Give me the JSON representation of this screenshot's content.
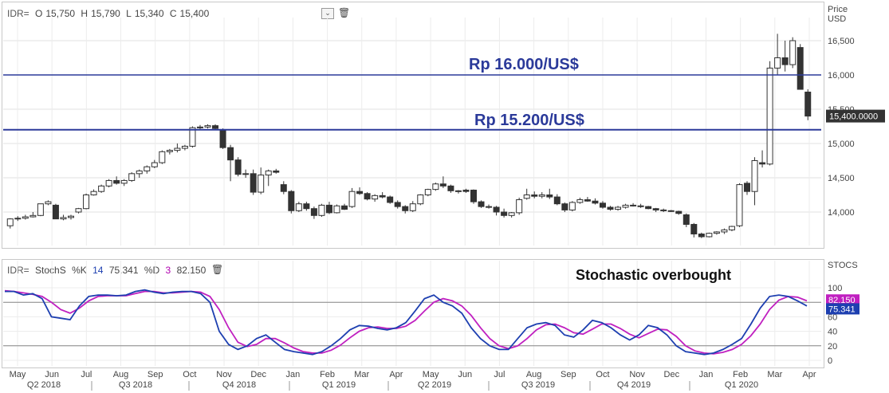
{
  "legend_price": {
    "symbol": "IDR=",
    "open_l": "O",
    "open": "15,750",
    "high_l": "H",
    "high": "15,790",
    "low_l": "L",
    "low": "15,340",
    "close_l": "C",
    "close": "15,400"
  },
  "legend_stoch": {
    "symbol": "IDR=",
    "name": "StochS",
    "k_l": "%K",
    "k_period": "14",
    "k": "75.341",
    "d_l": "%D",
    "d_period": "3",
    "d": "82.150"
  },
  "axis": {
    "price_title_1": "Price",
    "price_title_2": "USD",
    "stoch_title": "STOCS"
  },
  "annotations": {
    "level_high": "Rp 16.000/US$",
    "level_low": "Rp 15.200/US$",
    "stoch": "Stochastic overbought"
  },
  "colors": {
    "k": "#1d3fb0",
    "d": "#c020c0",
    "line": "#2b3a9a",
    "bull": "#ffffff",
    "bear": "#333333",
    "last": "#333333"
  },
  "chart_data": [
    {
      "type": "candlestick",
      "title": "",
      "ylabel": "Price USD",
      "ylim": [
        13500,
        16700
      ],
      "yticks": [
        14000,
        14500,
        15000,
        15500,
        16000,
        16500
      ],
      "ytick_labels": [
        "14,000",
        "14,500",
        "15,000",
        "15,500",
        "16,000",
        "16,500"
      ],
      "hlines": [
        16000,
        15200
      ],
      "last_label": "15,400.0000",
      "last_value": 15400,
      "x_months": [
        "May",
        "Jun",
        "Jul",
        "Aug",
        "Sep",
        "Oct",
        "Nov",
        "Dec",
        "Jan",
        "Feb",
        "Mar",
        "Apr",
        "May",
        "Jun",
        "Jul",
        "Aug",
        "Sep",
        "Oct",
        "Nov",
        "Dec",
        "Jan",
        "Feb",
        "Mar",
        "Apr"
      ],
      "x_quarters": [
        "Q2 2018",
        "Q3 2018",
        "Q4 2018",
        "Q1 2019",
        "Q2 2019",
        "Q3 2019",
        "Q4 2019",
        "Q1 2020"
      ],
      "ohlc": [
        [
          13800,
          13910,
          13760,
          13900
        ],
        [
          13900,
          13940,
          13870,
          13910
        ],
        [
          13910,
          13960,
          13890,
          13930
        ],
        [
          13930,
          14000,
          13920,
          13950
        ],
        [
          13950,
          14120,
          13940,
          14120
        ],
        [
          14120,
          14170,
          14100,
          14150
        ],
        [
          14100,
          14120,
          13900,
          13900
        ],
        [
          13900,
          13960,
          13880,
          13920
        ],
        [
          13920,
          13960,
          13890,
          13940
        ],
        [
          14000,
          14060,
          13980,
          14050
        ],
        [
          14050,
          14270,
          14040,
          14250
        ],
        [
          14250,
          14330,
          14240,
          14300
        ],
        [
          14300,
          14400,
          14280,
          14380
        ],
        [
          14380,
          14480,
          14360,
          14460
        ],
        [
          14460,
          14520,
          14400,
          14420
        ],
        [
          14420,
          14480,
          14380,
          14460
        ],
        [
          14460,
          14580,
          14440,
          14560
        ],
        [
          14560,
          14620,
          14500,
          14600
        ],
        [
          14600,
          14680,
          14560,
          14660
        ],
        [
          14660,
          14760,
          14640,
          14720
        ],
        [
          14720,
          14900,
          14700,
          14880
        ],
        [
          14880,
          14920,
          14840,
          14900
        ],
        [
          14900,
          15000,
          14870,
          14930
        ],
        [
          14930,
          14980,
          14900,
          14960
        ],
        [
          14960,
          15250,
          14940,
          15230
        ],
        [
          15230,
          15270,
          15200,
          15240
        ],
        [
          15240,
          15280,
          15220,
          15260
        ],
        [
          15260,
          15280,
          15200,
          15220
        ],
        [
          15200,
          15220,
          14920,
          14940
        ],
        [
          14940,
          14980,
          14450,
          14760
        ],
        [
          14760,
          14800,
          14520,
          14550
        ],
        [
          14550,
          14620,
          14500,
          14560
        ],
        [
          14560,
          14620,
          14250,
          14290
        ],
        [
          14290,
          14650,
          14260,
          14540
        ],
        [
          14540,
          14620,
          14380,
          14600
        ],
        [
          14600,
          14630,
          14560,
          14580
        ],
        [
          14400,
          14450,
          14260,
          14300
        ],
        [
          14300,
          14320,
          13980,
          14020
        ],
        [
          14020,
          14150,
          14000,
          14120
        ],
        [
          14120,
          14150,
          14020,
          14050
        ],
        [
          14050,
          14080,
          13900,
          13950
        ],
        [
          13950,
          14120,
          13930,
          14100
        ],
        [
          14100,
          14150,
          13970,
          13990
        ],
        [
          13990,
          14110,
          13980,
          14090
        ],
        [
          14090,
          14120,
          14030,
          14040
        ],
        [
          14080,
          14350,
          14060,
          14300
        ],
        [
          14300,
          14360,
          14250,
          14270
        ],
        [
          14270,
          14290,
          14170,
          14190
        ],
        [
          14190,
          14260,
          14150,
          14240
        ],
        [
          14240,
          14290,
          14200,
          14220
        ],
        [
          14220,
          14240,
          14120,
          14140
        ],
        [
          14140,
          14170,
          14050,
          14080
        ],
        [
          14080,
          14100,
          13980,
          14020
        ],
        [
          14020,
          14160,
          14000,
          14120
        ],
        [
          14120,
          14260,
          14100,
          14250
        ],
        [
          14250,
          14340,
          14230,
          14330
        ],
        [
          14330,
          14430,
          14310,
          14410
        ],
        [
          14410,
          14520,
          14350,
          14380
        ],
        [
          14380,
          14400,
          14280,
          14310
        ],
        [
          14310,
          14320,
          14270,
          14300
        ],
        [
          14320,
          14340,
          14280,
          14300
        ],
        [
          14320,
          14330,
          14120,
          14150
        ],
        [
          14150,
          14170,
          14060,
          14080
        ],
        [
          14080,
          14110,
          14050,
          14080
        ],
        [
          14070,
          14090,
          13950,
          14000
        ],
        [
          14000,
          14050,
          13920,
          13950
        ],
        [
          13950,
          14000,
          13920,
          13990
        ],
        [
          13990,
          14210,
          13960,
          14180
        ],
        [
          14200,
          14340,
          14180,
          14250
        ],
        [
          14250,
          14300,
          14200,
          14230
        ],
        [
          14230,
          14290,
          14200,
          14250
        ],
        [
          14250,
          14340,
          14190,
          14220
        ],
        [
          14220,
          14260,
          14100,
          14120
        ],
        [
          14120,
          14140,
          14000,
          14030
        ],
        [
          14030,
          14160,
          14010,
          14140
        ],
        [
          14140,
          14210,
          14120,
          14180
        ],
        [
          14180,
          14220,
          14150,
          14160
        ],
        [
          14160,
          14200,
          14110,
          14130
        ],
        [
          14130,
          14160,
          14050,
          14070
        ],
        [
          14070,
          14090,
          14020,
          14040
        ],
        [
          14040,
          14090,
          14020,
          14070
        ],
        [
          14070,
          14120,
          14050,
          14100
        ],
        [
          14100,
          14130,
          14080,
          14090
        ],
        [
          14090,
          14120,
          14060,
          14080
        ],
        [
          14080,
          14090,
          14040,
          14050
        ],
        [
          14050,
          14060,
          14000,
          14030
        ],
        [
          14030,
          14050,
          14000,
          14020
        ],
        [
          14020,
          14030,
          14000,
          14010
        ],
        [
          14010,
          14020,
          13960,
          13980
        ],
        [
          13960,
          13980,
          13780,
          13820
        ],
        [
          13820,
          13840,
          13630,
          13680
        ],
        [
          13680,
          13700,
          13620,
          13640
        ],
        [
          13640,
          13700,
          13630,
          13690
        ],
        [
          13690,
          13720,
          13670,
          13710
        ],
        [
          13710,
          13760,
          13680,
          13740
        ],
        [
          13740,
          13800,
          13720,
          13790
        ],
        [
          13800,
          14420,
          13780,
          14400
        ],
        [
          14420,
          14450,
          14250,
          14300
        ],
        [
          14300,
          14800,
          14100,
          14750
        ],
        [
          14720,
          14900,
          14650,
          14700
        ],
        [
          14700,
          16200,
          14680,
          16100
        ],
        [
          16100,
          16600,
          16000,
          16250
        ],
        [
          16250,
          16500,
          16050,
          16150
        ],
        [
          16150,
          16550,
          16100,
          16500
        ],
        [
          16400,
          16450,
          15790,
          15790
        ],
        [
          15750,
          15790,
          15340,
          15400
        ]
      ]
    },
    {
      "type": "line",
      "title": "",
      "ylim": [
        0,
        100
      ],
      "yticks": [
        0,
        20,
        40,
        60,
        80,
        100
      ],
      "ytick_labels": [
        "0",
        "20",
        "40",
        "60",
        "80",
        "100"
      ],
      "hlines": [
        80,
        20
      ],
      "last_k": "75.341",
      "last_d": "82.150",
      "series": [
        {
          "name": "%K",
          "values": [
            95,
            95,
            90,
            92,
            85,
            60,
            58,
            56,
            75,
            88,
            90,
            90,
            89,
            90,
            95,
            97,
            94,
            92,
            94,
            95,
            95,
            92,
            80,
            40,
            22,
            15,
            20,
            30,
            35,
            25,
            15,
            12,
            10,
            8,
            12,
            20,
            30,
            42,
            48,
            47,
            44,
            42,
            45,
            52,
            68,
            85,
            90,
            80,
            75,
            65,
            45,
            30,
            20,
            15,
            15,
            30,
            45,
            50,
            52,
            48,
            35,
            32,
            42,
            55,
            52,
            45,
            35,
            28,
            35,
            48,
            45,
            35,
            20,
            12,
            10,
            8,
            10,
            15,
            22,
            30,
            50,
            72,
            88,
            90,
            88,
            82,
            75
          ]
        },
        {
          "name": "%D",
          "values": [
            96,
            95,
            93,
            91,
            88,
            80,
            70,
            65,
            72,
            82,
            88,
            89,
            89,
            89,
            92,
            95,
            95,
            93,
            93,
            94,
            95,
            94,
            88,
            70,
            45,
            25,
            19,
            22,
            30,
            30,
            24,
            17,
            12,
            10,
            10,
            14,
            21,
            31,
            40,
            45,
            46,
            44,
            44,
            47,
            55,
            68,
            80,
            85,
            82,
            75,
            62,
            45,
            30,
            20,
            16,
            20,
            30,
            42,
            49,
            50,
            45,
            38,
            36,
            43,
            50,
            50,
            44,
            36,
            31,
            37,
            43,
            42,
            33,
            20,
            13,
            10,
            9,
            11,
            15,
            22,
            34,
            50,
            70,
            83,
            88,
            87,
            82
          ]
        }
      ]
    }
  ]
}
